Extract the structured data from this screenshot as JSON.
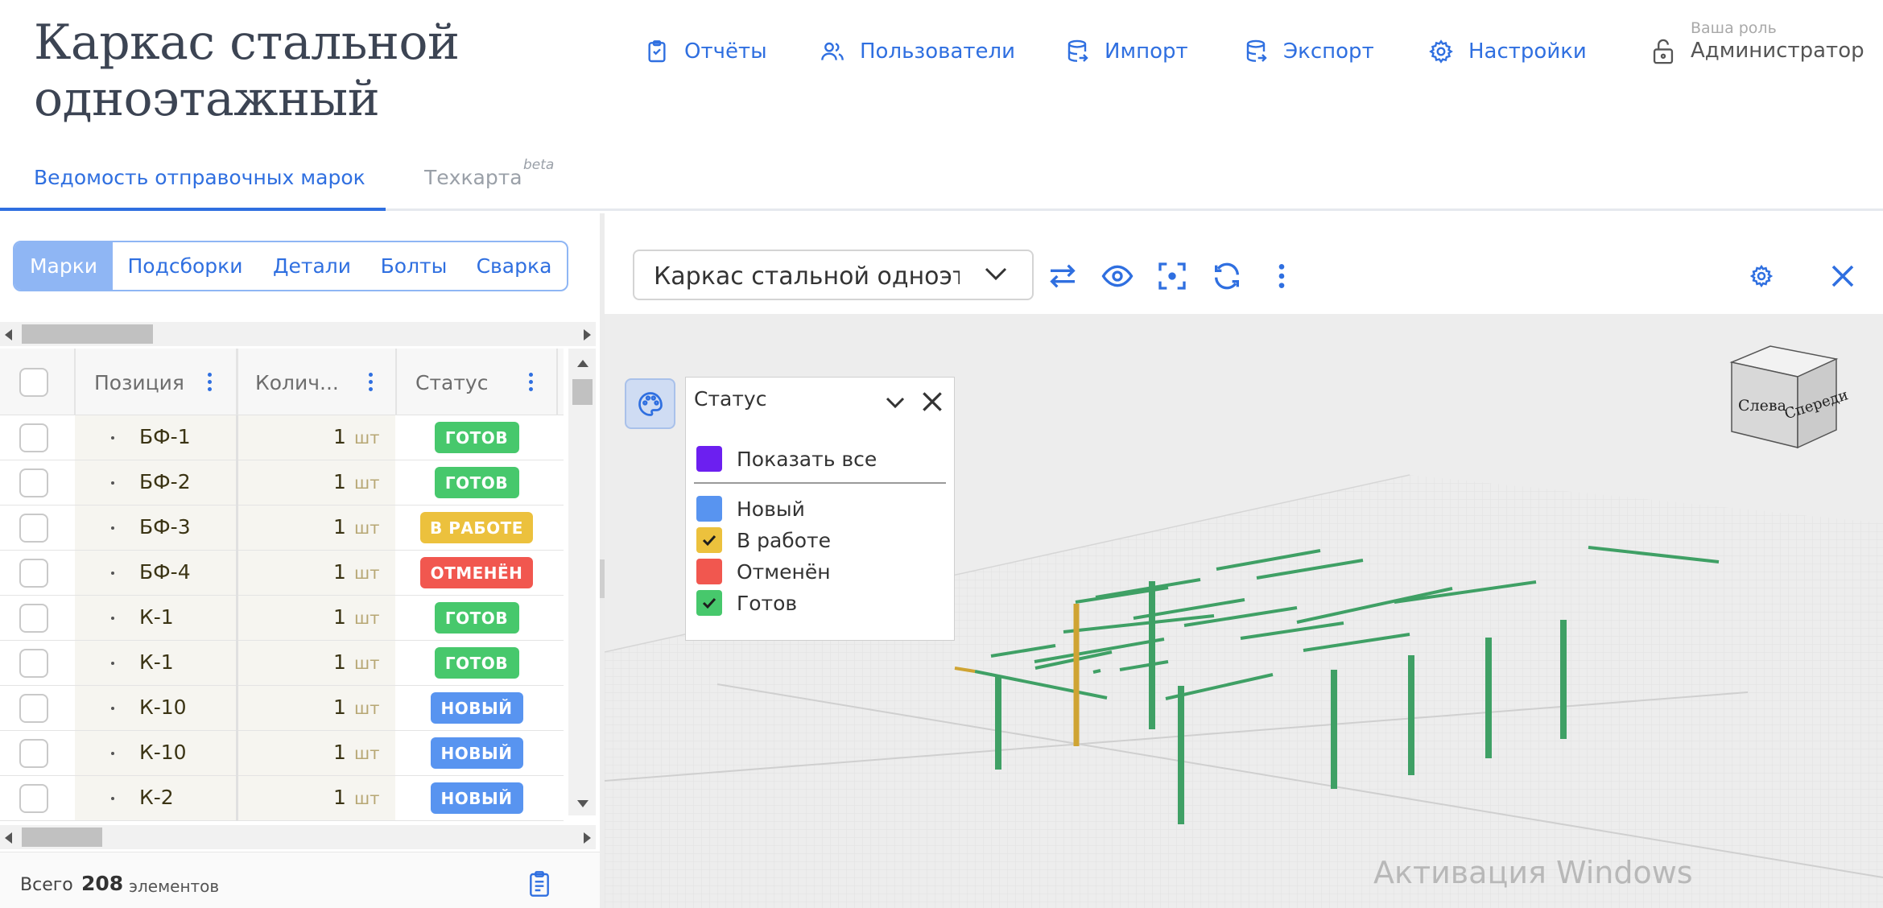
{
  "header": {
    "title": "Каркас стальной одноэтажный",
    "nav": [
      {
        "label": "Отчёты",
        "icon": "clipboard-icon"
      },
      {
        "label": "Пользователи",
        "icon": "users-icon"
      },
      {
        "label": "Импорт",
        "icon": "database-import-icon"
      },
      {
        "label": "Экспорт",
        "icon": "database-export-icon"
      },
      {
        "label": "Настройки",
        "icon": "gear-icon"
      }
    ],
    "role": {
      "caption": "Ваша роль",
      "value": "Администратор",
      "icon": "unlock-icon"
    }
  },
  "tabs": [
    {
      "label": "Ведомость отправочных марок",
      "active": true
    },
    {
      "label": "Техкарта",
      "badge": "beta",
      "active": false
    }
  ],
  "segments": [
    {
      "label": "Марки",
      "active": true
    },
    {
      "label": "Подсборки"
    },
    {
      "label": "Детали"
    },
    {
      "label": "Болты"
    },
    {
      "label": "Сварка"
    }
  ],
  "table": {
    "columns": [
      "Позиция",
      "Колич...",
      "Статус"
    ],
    "rows": [
      {
        "position": "БФ-1",
        "qty": "1",
        "unit": "шт",
        "status": "ГОТОВ"
      },
      {
        "position": "БФ-2",
        "qty": "1",
        "unit": "шт",
        "status": "ГОТОВ"
      },
      {
        "position": "БФ-3",
        "qty": "1",
        "unit": "шт",
        "status": "В РАБОТЕ"
      },
      {
        "position": "БФ-4",
        "qty": "1",
        "unit": "шт",
        "status": "ОТМЕНЁН"
      },
      {
        "position": "К-1",
        "qty": "1",
        "unit": "шт",
        "status": "ГОТОВ"
      },
      {
        "position": "К-1",
        "qty": "1",
        "unit": "шт",
        "status": "ГОТОВ"
      },
      {
        "position": "К-10",
        "qty": "1",
        "unit": "шт",
        "status": "НОВЫЙ"
      },
      {
        "position": "К-10",
        "qty": "1",
        "unit": "шт",
        "status": "НОВЫЙ"
      },
      {
        "position": "К-2",
        "qty": "1",
        "unit": "шт",
        "status": "НОВЫЙ"
      }
    ]
  },
  "status_colors": {
    "ГОТОВ": "#47c86c",
    "В РАБОТЕ": "#ecc13d",
    "ОТМЕНЁН": "#f1574f",
    "НОВЫЙ": "#5894f0"
  },
  "footer": {
    "prefix": "Всего",
    "count": "208",
    "suffix": "элементов"
  },
  "viewer": {
    "model": "Каркас стальной одноэтажный",
    "tools": [
      "swap-icon",
      "eye-icon",
      "focus-icon",
      "refresh-icon",
      "more-vertical-icon",
      "gear-icon",
      "close-icon"
    ],
    "legend": {
      "title": "Статус",
      "show_all": "Показать все",
      "items": [
        {
          "label": "Новый",
          "color": "#5894f0",
          "checked": false
        },
        {
          "label": "В работе",
          "color": "#ecc13d",
          "checked": true
        },
        {
          "label": "Отменён",
          "color": "#f1574f",
          "checked": false
        },
        {
          "label": "Готов",
          "color": "#47c86c",
          "checked": true
        }
      ],
      "show_all_color": "#6c1ff0"
    },
    "cube": {
      "left": "Слева",
      "front": "Спереди"
    },
    "watermark": "Активация Windows"
  }
}
